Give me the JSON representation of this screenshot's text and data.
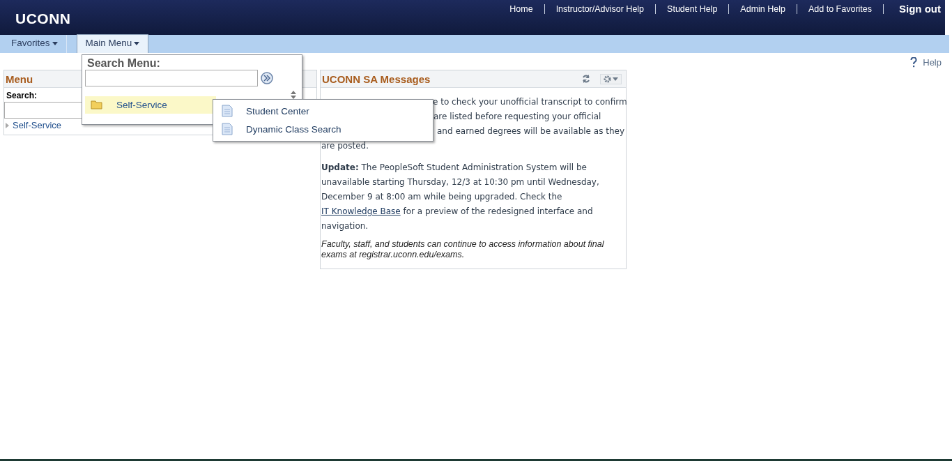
{
  "header": {
    "logo": "UCONN",
    "links": [
      "Home",
      "Instructor/Advisor Help",
      "Student Help",
      "Admin Help",
      "Add to Favorites"
    ],
    "sign_out": "Sign out"
  },
  "nav": {
    "tabs": [
      {
        "label": "Favorites",
        "selected": false
      },
      {
        "label": "Main Menu",
        "selected": true
      }
    ]
  },
  "help_link": "Help",
  "menu_panel": {
    "title": "Menu",
    "search_label": "Search:",
    "items": [
      {
        "label": "Self-Service",
        "expanded": false
      }
    ]
  },
  "dropdown": {
    "title": "Search Menu:",
    "items": [
      {
        "label": "Self-Service",
        "selected": true
      }
    ],
    "flyout": [
      "Student Center",
      "Dynamic Class Search"
    ]
  },
  "messages": {
    "title": "UCONN SA Messages",
    "covered_lines": [
      "e to check your unofficial transcript to confirm",
      "are listed before requesting your official",
      "and earned degrees will be available as they",
      "are posted."
    ],
    "update": "**Update:**  The PeopleSoft Student Administration System will be unavailable starting Thursday, 12/3 at 10:30 pm until Wednesday, December 9 at 8:00 am while being upgraded. Check the",
    "update_link": "IT Knowledge Base",
    "update_rest": "for a preview of the redesigned interface and navigation.",
    "note": "Faculty, staff, and students can continue to access information about final exams at registrar.uconn.edu/exams."
  }
}
